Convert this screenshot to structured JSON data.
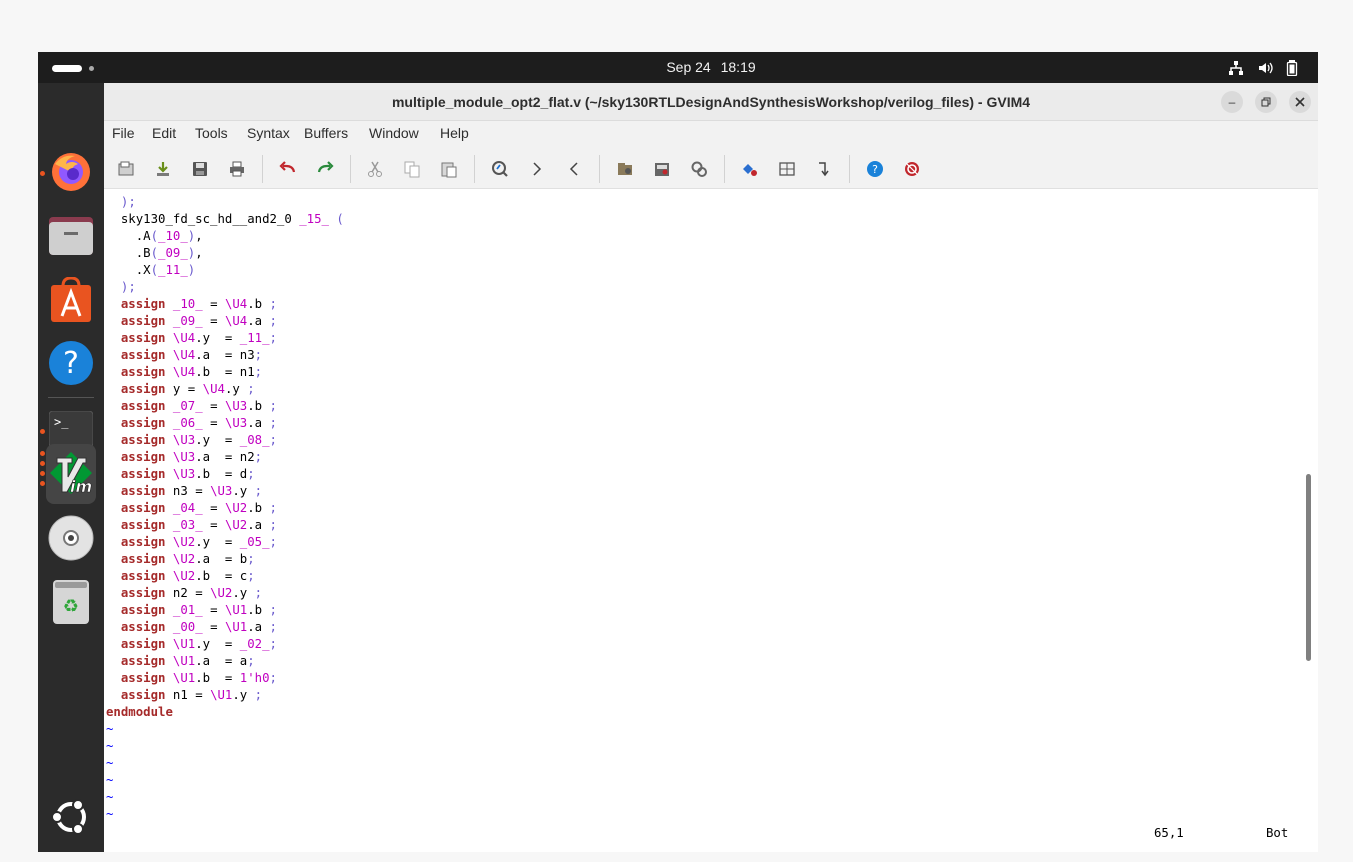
{
  "topbar": {
    "date": "Sep 24",
    "time": "18:19"
  },
  "dock": {
    "items": [
      {
        "icon": "firefox-icon",
        "running": true
      },
      {
        "icon": "files-icon",
        "running": false
      },
      {
        "icon": "app-center-icon",
        "running": false
      },
      {
        "icon": "help-icon",
        "running": false
      },
      {
        "icon": "terminal-icon",
        "running": true
      },
      {
        "icon": "vim-icon",
        "running": true,
        "active": true
      },
      {
        "icon": "disc-icon",
        "running": false
      },
      {
        "icon": "trash-icon",
        "running": false
      },
      {
        "icon": "ubuntu-logo-icon",
        "running": false
      }
    ]
  },
  "window": {
    "title": "multiple_module_opt2_flat.v (~/sky130RTLDesignAndSynthesisWorkshop/verilog_files) - GVIM4",
    "menus": [
      "File",
      "Edit",
      "Tools",
      "Syntax",
      "Buffers",
      "Window",
      "Help"
    ]
  },
  "toolbar": {
    "items": [
      "open-icon",
      "load-session-icon",
      "save-icon",
      "print-icon",
      "undo-icon",
      "redo-icon",
      "cut-icon",
      "copy-icon",
      "paste-icon",
      "find-replace-icon",
      "find-next-icon",
      "find-prev-icon",
      "load-script-icon",
      "make-icon",
      "run-ctags-icon",
      "tag-jump-icon",
      "split-window-icon",
      "tag-back-icon",
      "help-icon",
      "find-help-icon"
    ]
  },
  "editor": {
    "lines": [
      "  );",
      "  sky130_fd_sc_hd__and2_0 _15_ (",
      "    .A(_10_),",
      "    .B(_09_),",
      "    .X(_11_)",
      "  );",
      "  assign _10_ = \\U4.b ;",
      "  assign _09_ = \\U4.a ;",
      "  assign \\U4.y  = _11_;",
      "  assign \\U4.a  = n3;",
      "  assign \\U4.b  = n1;",
      "  assign y = \\U4.y ;",
      "  assign _07_ = \\U3.b ;",
      "  assign _06_ = \\U3.a ;",
      "  assign \\U3.y  = _08_;",
      "  assign \\U3.a  = n2;",
      "  assign \\U3.b  = d;",
      "  assign n3 = \\U3.y ;",
      "  assign _04_ = \\U2.b ;",
      "  assign _03_ = \\U2.a ;",
      "  assign \\U2.y  = _05_;",
      "  assign \\U2.a  = b;",
      "  assign \\U2.b  = c;",
      "  assign n2 = \\U2.y ;",
      "  assign _01_ = \\U1.b ;",
      "  assign _00_ = \\U1.a ;",
      "  assign \\U1.y  = _02_;",
      "  assign \\U1.a  = a;",
      "  assign \\U1.b  = 1'h0;",
      "  assign n1 = \\U1.y ;",
      "endmodule",
      "~",
      "~",
      "~",
      "~",
      "~",
      "~"
    ]
  },
  "status": {
    "position": "65,1",
    "scroll": "Bot"
  }
}
